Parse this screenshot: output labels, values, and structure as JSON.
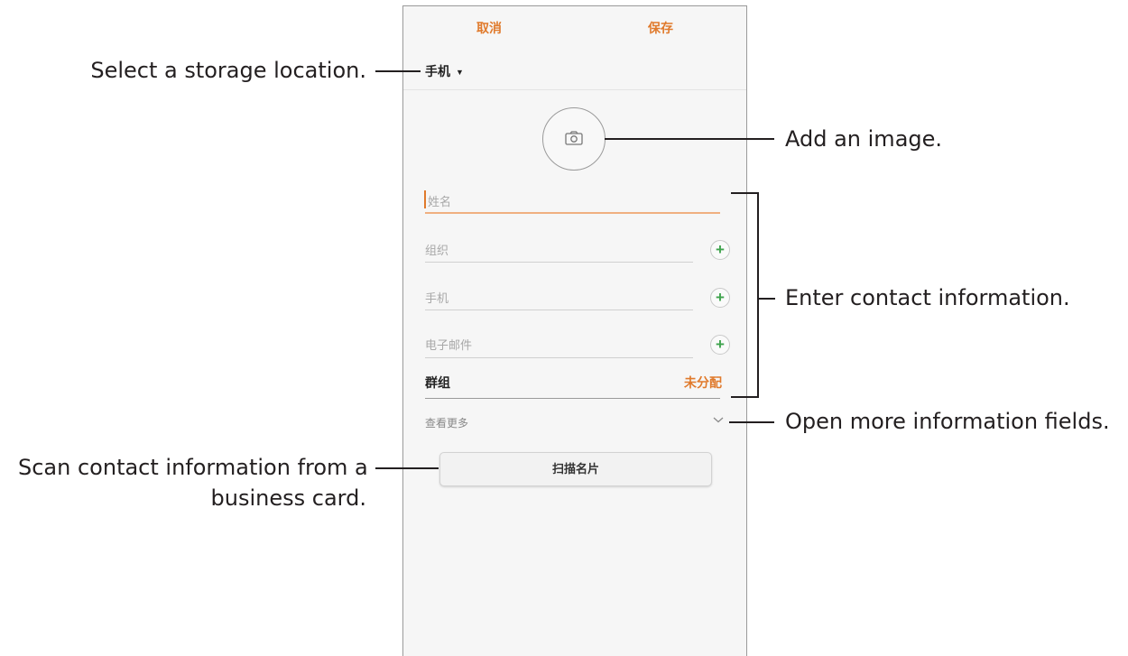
{
  "action_bar": {
    "cancel": "取消",
    "save": "保存"
  },
  "storage": {
    "label": "手机",
    "caret": "▼"
  },
  "fields": {
    "name": {
      "placeholder": "姓名"
    },
    "organization": {
      "placeholder": "组织"
    },
    "phone": {
      "placeholder": "手机"
    },
    "email": {
      "placeholder": "电子邮件"
    }
  },
  "group": {
    "label": "群组",
    "value": "未分配"
  },
  "more": {
    "label": "查看更多"
  },
  "scan_button": {
    "label": "扫描名片"
  },
  "plus_glyph": "+",
  "callouts": {
    "storage": "Select a storage location.",
    "image": "Add an image.",
    "contact": "Enter contact information.",
    "more": "Open more information fields.",
    "scan_line1": "Scan contact information from a",
    "scan_line2": "business card."
  },
  "colors": {
    "accent": "#e07a2c",
    "plus": "#3fa34d"
  },
  "icons": {
    "avatar": "camera-icon",
    "add": "plus-circle-icon",
    "expand": "chevron-down-icon"
  }
}
